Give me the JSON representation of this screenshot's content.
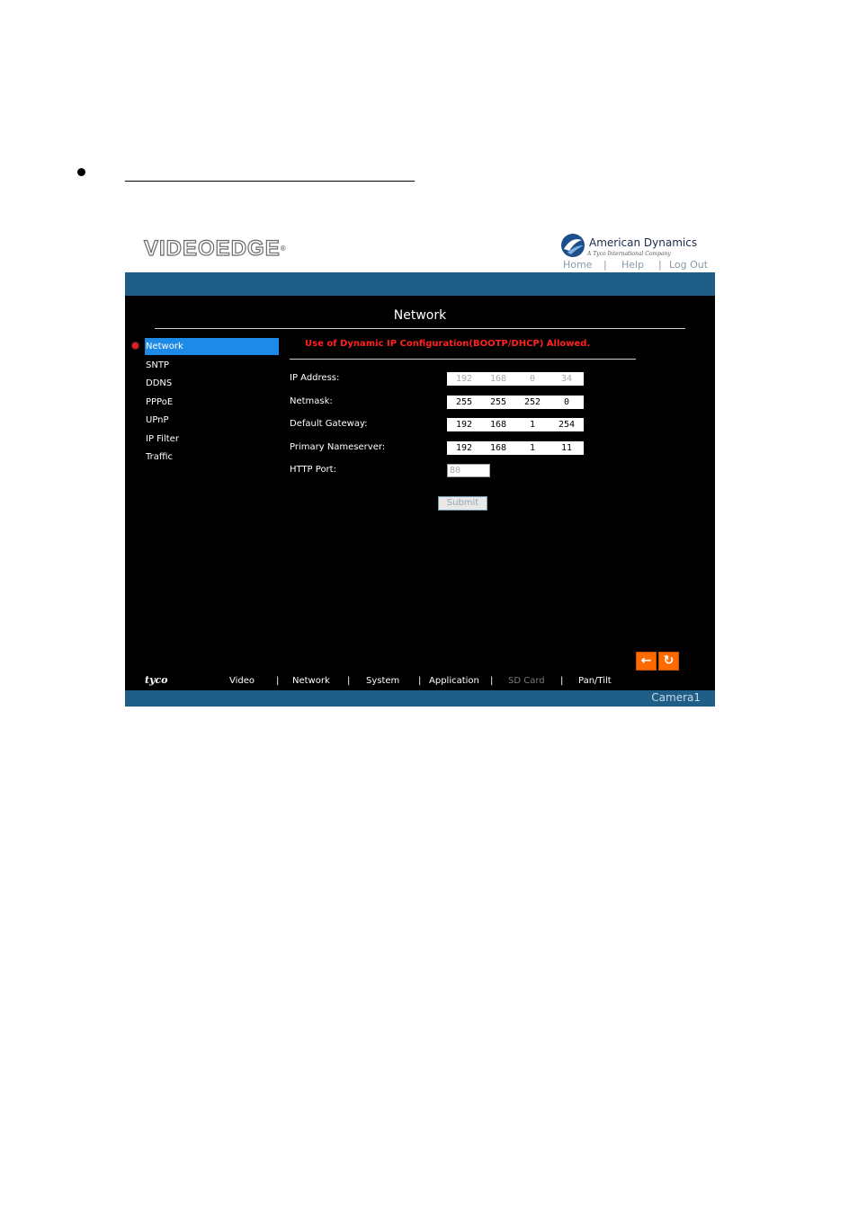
{
  "header": {
    "logo_text": "VIDEOEDGE",
    "logo_mark": "®",
    "company_name": "American Dynamics",
    "company_tagline": "A Tyco International Company",
    "links": [
      "Home",
      "Help",
      "Log Out"
    ]
  },
  "page": {
    "title": "Network"
  },
  "sidebar": {
    "items": [
      {
        "label": "Network",
        "active": true
      },
      {
        "label": "SNTP"
      },
      {
        "label": "DDNS"
      },
      {
        "label": "PPPoE"
      },
      {
        "label": "UPnP"
      },
      {
        "label": "IP Filter"
      },
      {
        "label": "Traffic"
      }
    ]
  },
  "form": {
    "notice": "Use of Dynamic IP Configuration(BOOTP/DHCP) Allowed.",
    "ip_address": {
      "label": "IP Address:",
      "octets": [
        "192",
        "168",
        "0",
        "34"
      ]
    },
    "netmask": {
      "label": "Netmask:",
      "octets": [
        "255",
        "255",
        "252",
        "0"
      ]
    },
    "gateway": {
      "label": "Default Gateway:",
      "octets": [
        "192",
        "168",
        "1",
        "254"
      ]
    },
    "nameserver": {
      "label": "Primary Nameserver:",
      "octets": [
        "192",
        "168",
        "1",
        "11"
      ]
    },
    "http_port": {
      "label": "HTTP Port:",
      "value": "80"
    },
    "submit_label": "Submit"
  },
  "footer": {
    "brand": "tyco",
    "nav": [
      "Video",
      "Network",
      "System",
      "Application",
      "SD Card",
      "Pan/Tilt"
    ],
    "separator": "|",
    "camera_name": "Camera1",
    "back_icon": "←",
    "refresh_icon": "↻"
  },
  "colors": {
    "bar_blue": "#1f5e86",
    "active_blue": "#1e8ae8",
    "notice_red": "#ff2020",
    "button_orange": "#ff6a00"
  }
}
